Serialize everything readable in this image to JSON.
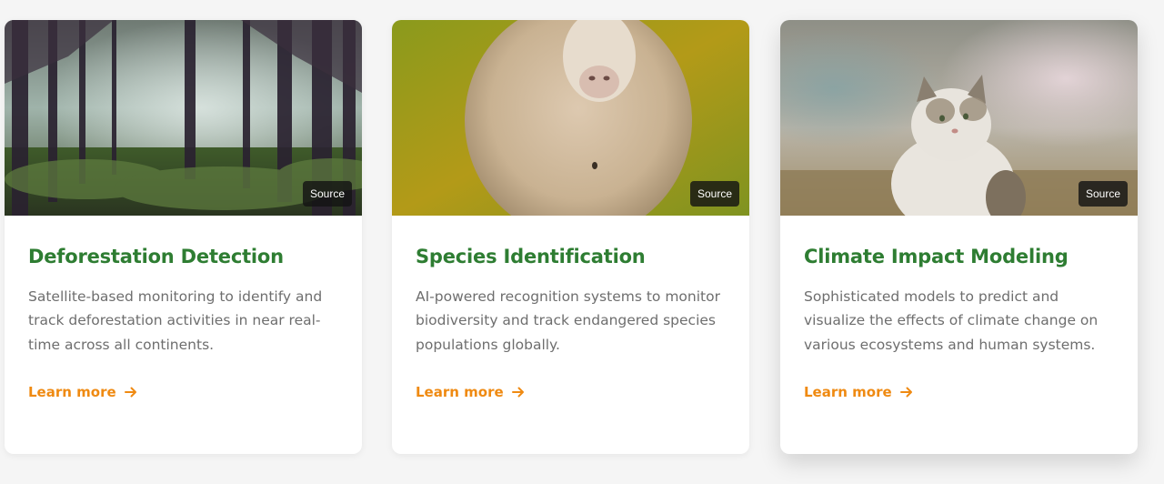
{
  "cards": [
    {
      "title": "Deforestation Detection",
      "description": "Satellite-based monitoring to identify and track deforestation activities in near real-time across all continents.",
      "badge": "Source",
      "link_label": "Learn more",
      "image": "misty-forest-photo"
    },
    {
      "title": "Species Identification",
      "description": "AI-powered recognition systems to monitor biodiversity and track endangered species populations globally.",
      "badge": "Source",
      "link_label": "Learn more",
      "image": "sheep-in-meadow-photo"
    },
    {
      "title": "Climate Impact Modeling",
      "description": "Sophisticated models to predict and visualize the effects of climate change on various ecosystems and human systems.",
      "badge": "Source",
      "link_label": "Learn more",
      "image": "cat-in-grass-photo"
    }
  ],
  "colors": {
    "title": "#2e7d32",
    "link": "#ef8a12",
    "text": "#6e6e6e",
    "page_bg": "#f5f5f5"
  },
  "icons": {
    "link_arrow": "arrow-right-icon"
  }
}
